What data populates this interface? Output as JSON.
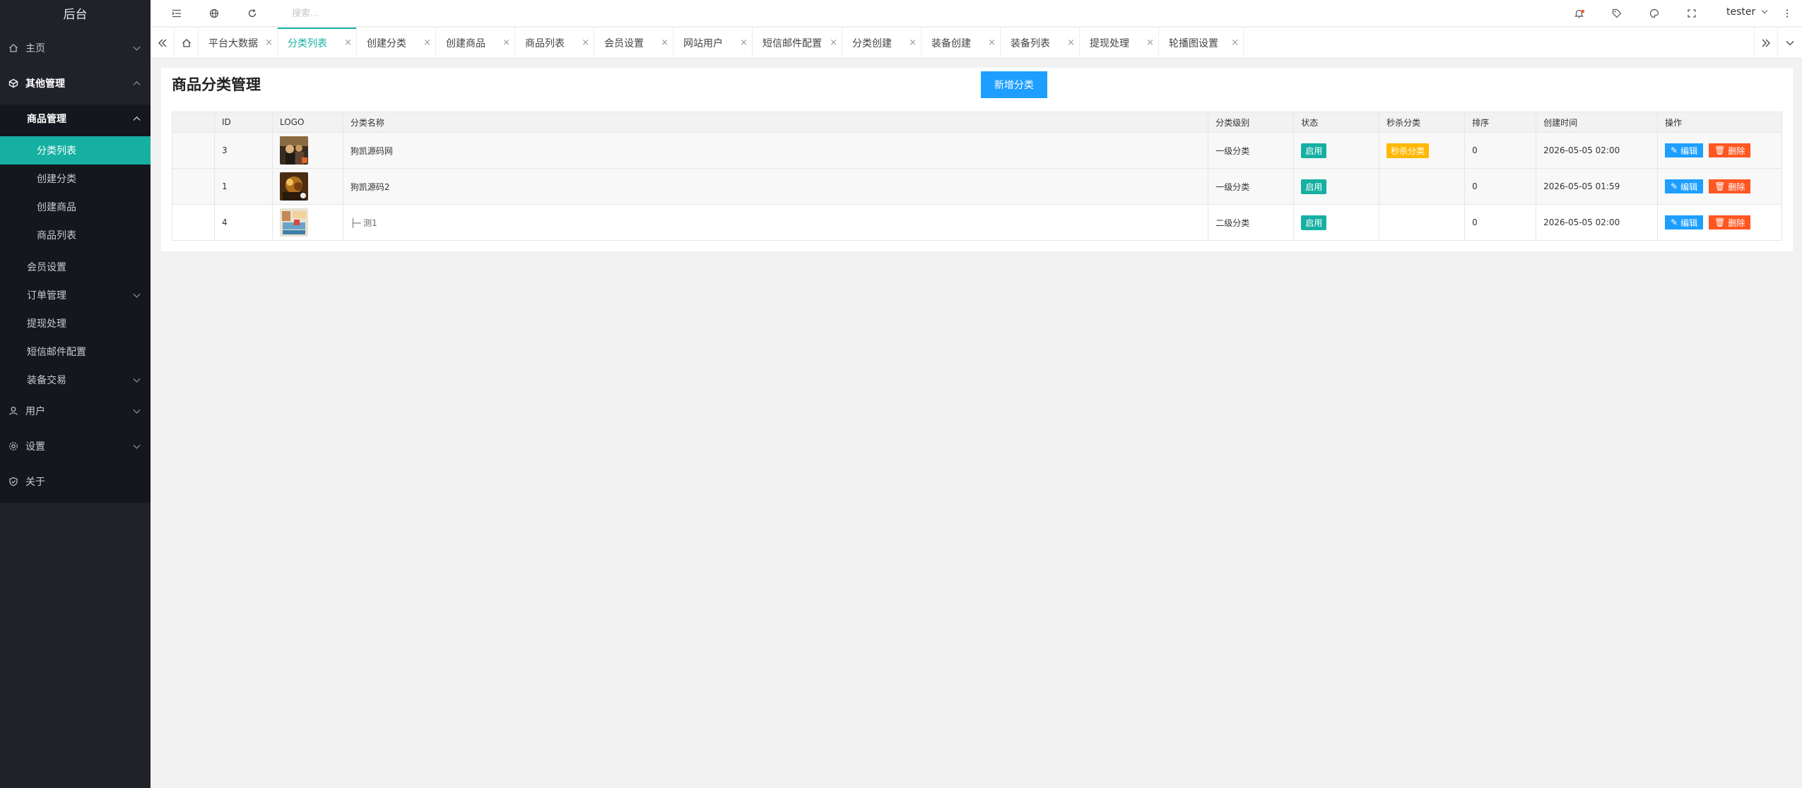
{
  "sidebar": {
    "logo": "后台",
    "items": [
      {
        "label": "主页"
      },
      {
        "label": "其他管理"
      },
      {
        "label": "商品管理"
      },
      {
        "label": "分类列表"
      },
      {
        "label": "创建分类"
      },
      {
        "label": "创建商品"
      },
      {
        "label": "商品列表"
      },
      {
        "label": "会员设置"
      },
      {
        "label": "订单管理"
      },
      {
        "label": "提现处理"
      },
      {
        "label": "短信邮件配置"
      },
      {
        "label": "装备交易"
      },
      {
        "label": "用户"
      },
      {
        "label": "设置"
      },
      {
        "label": "关于"
      }
    ]
  },
  "header": {
    "search_placeholder": "搜索...",
    "user": "tester"
  },
  "tabs": [
    {
      "label": "平台大数据"
    },
    {
      "label": "分类列表"
    },
    {
      "label": "创建分类"
    },
    {
      "label": "创建商品"
    },
    {
      "label": "商品列表"
    },
    {
      "label": "会员设置"
    },
    {
      "label": "网站用户"
    },
    {
      "label": "短信邮件配置"
    },
    {
      "label": "分类创建"
    },
    {
      "label": "装备创建"
    },
    {
      "label": "装备列表"
    },
    {
      "label": "提现处理"
    },
    {
      "label": "轮播图设置"
    }
  ],
  "tab_close": "×",
  "main": {
    "title": "商品分类管理",
    "add_button": "新增分类",
    "columns": [
      "ID",
      "LOGO",
      "分类名称",
      "分类级别",
      "状态",
      "秒杀分类",
      "排序",
      "创建时间",
      "操作"
    ],
    "rows": [
      {
        "id": "3",
        "name": "狗凯源码网",
        "level": "一级分类",
        "status": "启用",
        "seckill": "秒杀分类",
        "sort": "0",
        "created": "2026-05-05 02:00"
      },
      {
        "id": "1",
        "name": "狗凯源码2",
        "level": "一级分类",
        "status": "启用",
        "seckill": "",
        "sort": "0",
        "created": "2026-05-05 01:59"
      },
      {
        "id": "4",
        "name": "├─ 测1",
        "level": "二级分类",
        "status": "启用",
        "seckill": "",
        "sort": "0",
        "created": "2026-05-05 02:00"
      }
    ],
    "edit_label": "编辑",
    "delete_label": "删除"
  },
  "colors": {
    "accent": "#16b0a2",
    "primary": "#1e9fff",
    "danger": "#ff5722",
    "warning": "#ffb800",
    "sidebar_bg": "#20222a"
  }
}
